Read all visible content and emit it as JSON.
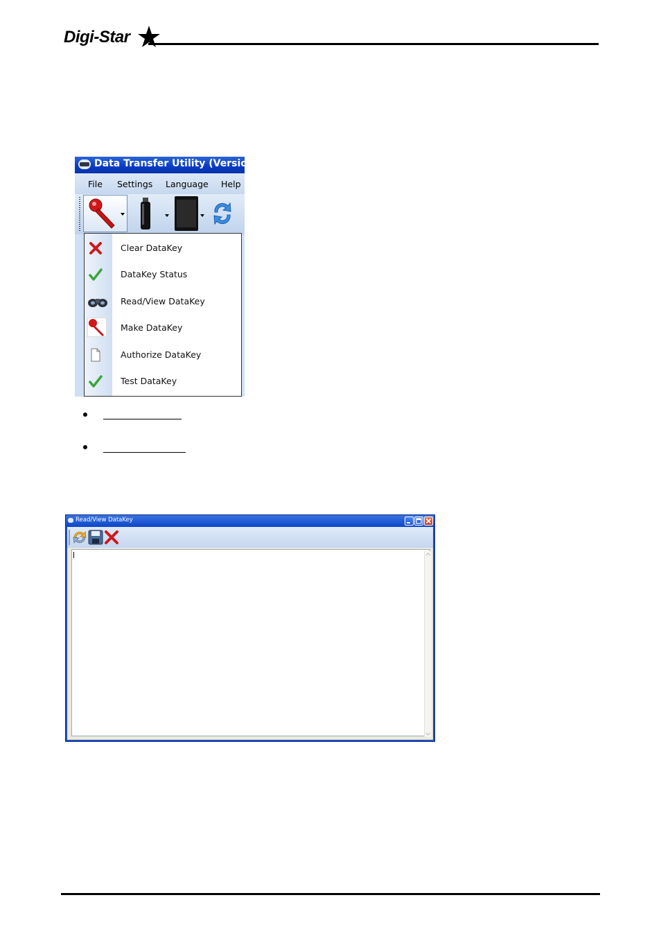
{
  "header": {
    "logo_text": "Digi-Star"
  },
  "dtu_window": {
    "title": "Data Transfer Utility (Version",
    "menu": [
      "File",
      "Settings",
      "Language",
      "Help"
    ],
    "toolbar_icons": [
      "datakey-icon",
      "usb-drive-icon",
      "sd-card-icon",
      "refresh-icon"
    ],
    "dropdown": [
      {
        "label": "Clear DataKey",
        "icon": "red-x-icon"
      },
      {
        "label": "DataKey Status",
        "icon": "green-check-icon"
      },
      {
        "label": "Read/View DataKey",
        "icon": "binoculars-icon"
      },
      {
        "label": "Make DataKey",
        "icon": "datakey-icon"
      },
      {
        "label": "Authorize DataKey",
        "icon": "blank-document-icon"
      },
      {
        "label": "Test DataKey",
        "icon": "green-check-icon"
      }
    ],
    "colors": {
      "title_bar": "#0a3cc2",
      "menu_bg": "#cfe0f4",
      "key_red": "#d01818",
      "check_green": "#3aa63a"
    }
  },
  "read_view_window": {
    "title": "Read/View DataKey",
    "toolbar_icons": [
      "refresh-icon",
      "save-icon",
      "close-icon"
    ],
    "text_content": ""
  }
}
